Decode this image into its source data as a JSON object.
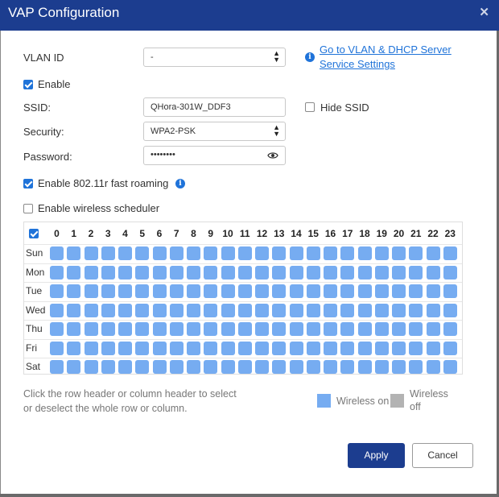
{
  "dialog": {
    "title": "VAP Configuration",
    "close_glyph": "✕"
  },
  "form": {
    "vlan_label": "VLAN ID",
    "vlan_value": "-",
    "vlan_link": "Go to VLAN & DHCP Server Service Settings",
    "enable_label": "Enable",
    "enable_checked": true,
    "ssid_label": "SSID:",
    "ssid_value": "QHora-301W_DDF3",
    "hide_ssid_label": "Hide SSID",
    "hide_ssid_checked": false,
    "security_label": "Security:",
    "security_value": "WPA2-PSK",
    "password_label": "Password:",
    "password_value": "••••••••",
    "fast_roaming_label": "Enable 802.11r fast roaming",
    "fast_roaming_checked": true,
    "scheduler_label": "Enable wireless scheduler",
    "scheduler_checked": false
  },
  "schedule": {
    "hours": [
      "0",
      "1",
      "2",
      "3",
      "4",
      "5",
      "6",
      "7",
      "8",
      "9",
      "10",
      "11",
      "12",
      "13",
      "14",
      "15",
      "16",
      "17",
      "18",
      "19",
      "20",
      "21",
      "22",
      "23"
    ],
    "days": [
      "Sun",
      "Mon",
      "Tue",
      "Wed",
      "Thu",
      "Fri",
      "Sat"
    ],
    "all_cells_state": "on",
    "select_all_checked": true
  },
  "help_text": "Click the row header or column header to select or deselect the whole row or column.",
  "legend": {
    "on_label": "Wireless on",
    "off_label": "Wireless off",
    "on_color": "#76acf1",
    "off_color": "#b3b3b3"
  },
  "buttons": {
    "apply": "Apply",
    "cancel": "Cancel"
  },
  "icons": {
    "info": "info-icon",
    "eye": "eye-icon",
    "close": "close-icon",
    "select_caret": "chevron-updown-icon"
  },
  "colors": {
    "header_bg": "#1c3d8f",
    "accent": "#1f73d9",
    "cell_on": "#76acf1"
  }
}
